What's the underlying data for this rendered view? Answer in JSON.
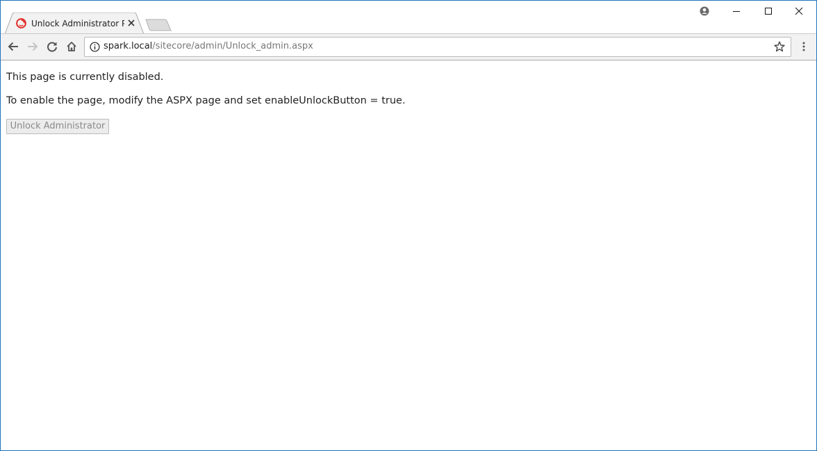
{
  "tab": {
    "title": "Unlock Administrator Page",
    "favicon": "sitecore-icon"
  },
  "window_controls": {
    "profile": "account-icon",
    "minimize": "minimize-icon",
    "maximize": "maximize-icon",
    "close": "close-icon"
  },
  "toolbar": {
    "back": "back-arrow-icon",
    "forward": "forward-arrow-icon",
    "reload": "reload-icon",
    "home": "home-icon",
    "menu": "more-vert-icon"
  },
  "address_bar": {
    "host": "spark.local",
    "path": "/sitecore/admin/Unlock_admin.aspx",
    "info": "info-icon",
    "bookmark": "star-icon"
  },
  "page": {
    "status_text": "This page is currently disabled.",
    "instruction_text": "To enable the page, modify the ASPX page and set enableUnlockButton = true.",
    "unlock_button_label": "Unlock Administrator",
    "unlock_button_disabled": true
  },
  "colors": {
    "window_border": "#1e73be",
    "toolbar_bg": "#f2f2f2",
    "favicon_red": "#e0201b",
    "disabled_text": "#8a8a8a"
  }
}
